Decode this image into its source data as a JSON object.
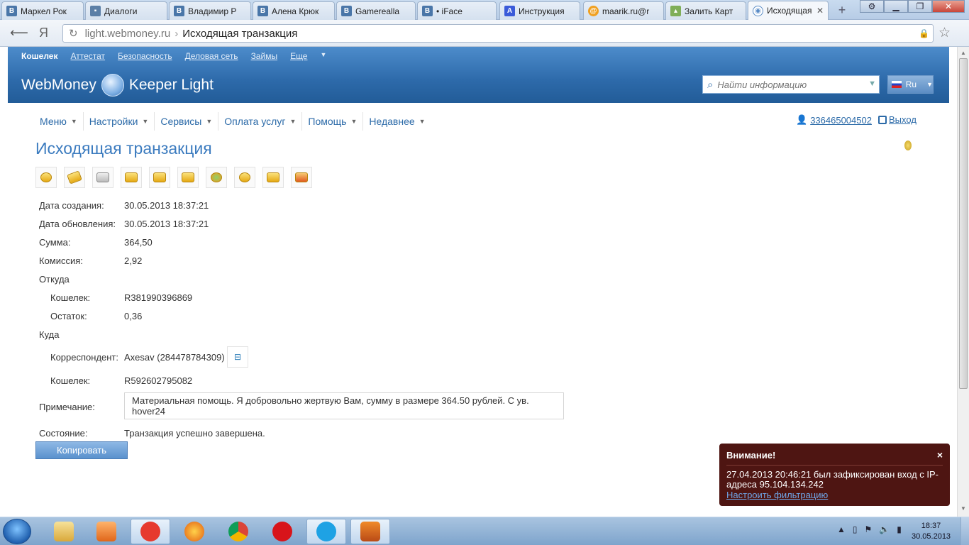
{
  "browser": {
    "tabs": [
      {
        "label": "Маркел Рок",
        "icon": "vk-icon",
        "fav": "В"
      },
      {
        "label": "Диалоги",
        "icon": "chat-icon",
        "fav": "▪"
      },
      {
        "label": "Владимир Р",
        "icon": "vk-icon",
        "fav": "В"
      },
      {
        "label": "Алена Крюк",
        "icon": "vk-icon",
        "fav": "В"
      },
      {
        "label": "Gamerealla",
        "icon": "vk-icon",
        "fav": "В"
      },
      {
        "label": "• iFace",
        "icon": "vk-icon",
        "fav": "В"
      },
      {
        "label": "Инструкция",
        "icon": "a-icon",
        "fav": "A"
      },
      {
        "label": "maarik.ru@r",
        "icon": "mail-icon",
        "fav": "@"
      },
      {
        "label": "Залить Карт",
        "icon": "upload-icon",
        "fav": "▴"
      },
      {
        "label": "Исходящая",
        "icon": "webmoney-icon",
        "fav": "◉"
      }
    ],
    "url_domain": "light.webmoney.ru",
    "url_separator": "›",
    "url_title": "Исходящая транзакция",
    "yandex_glyph": "Я"
  },
  "header": {
    "top_nav": [
      "Кошелек",
      "Аттестат",
      "Безопасность",
      "Деловая сеть",
      "Займы",
      "Еще"
    ],
    "logo_left": "WebMoney",
    "logo_right": "Keeper Light",
    "search_placeholder": "Найти информацию",
    "lang": "Ru"
  },
  "menu": {
    "items": [
      "Меню",
      "Настройки",
      "Сервисы",
      "Оплата услуг",
      "Помощь",
      "Недавнее"
    ],
    "user_id": "336465004502",
    "exit_label": "Выход"
  },
  "page": {
    "title": "Исходящая транзакция",
    "fields": {
      "created_label": "Дата создания:",
      "created_value": "30.05.2013 18:37:21",
      "updated_label": "Дата обновления:",
      "updated_value": "30.05.2013 18:37:21",
      "amount_label": "Сумма:",
      "amount_value": "364,50",
      "fee_label": "Комиссия:",
      "fee_value": "2,92",
      "from_label": "Откуда",
      "from_wallet_label": "Кошелек:",
      "from_wallet_value": "R381990396869",
      "balance_label": "Остаток:",
      "balance_value": "0,36",
      "to_label": "Куда",
      "correspondent_label": "Корреспондент:",
      "correspondent_value": "Axesav (284478784309)",
      "to_wallet_label": "Кошелек:",
      "to_wallet_value": "R592602795082",
      "note_label": "Примечание:",
      "note_value": "Материальная помощь. Я добровольно жертвую Вам, сумму в размере 364.50 рублей. С ув. hover24",
      "state_label": "Состояние:",
      "state_value": "Транзакция успешно завершена."
    },
    "copy_button": "Копировать"
  },
  "notification": {
    "title": "Внимание!",
    "close": "×",
    "text": "27.04.2013 20:46:21 был зафиксирован вход с IP-адреса 95.104.134.242",
    "link": "Настроить фильтрацию"
  },
  "taskbar": {
    "time": "18:37",
    "date": "30.05.2013"
  },
  "colors": {
    "accent": "#3b7bbf",
    "header": "#2d6aaa",
    "notification": "#4e1512"
  }
}
